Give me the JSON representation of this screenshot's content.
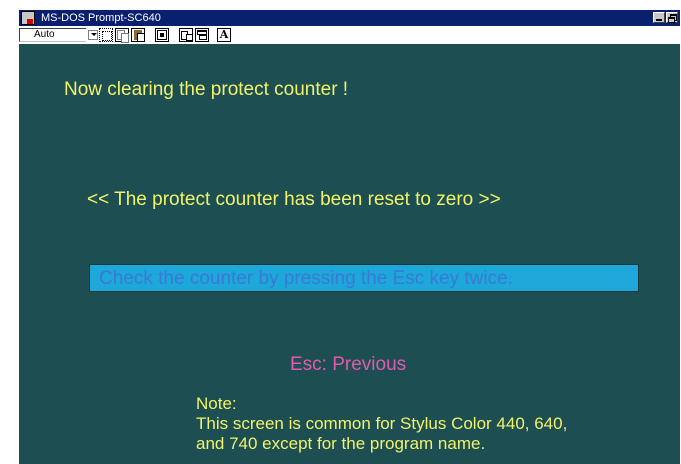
{
  "window": {
    "title": "MS-DOS Prompt-SC640",
    "controls": [
      "minimize",
      "restore"
    ]
  },
  "toolbar": {
    "font_size_value": "Auto",
    "buttons": [
      {
        "name": "mark",
        "icon": "mark-icon"
      },
      {
        "name": "copy",
        "icon": "copy-icon"
      },
      {
        "name": "paste",
        "icon": "paste-icon"
      },
      {
        "name": "full-screen",
        "icon": "fullscreen-icon"
      },
      {
        "name": "properties",
        "icon": "properties-icon"
      },
      {
        "name": "background",
        "icon": "background-icon"
      },
      {
        "name": "font",
        "icon": "font-icon",
        "label": "A"
      }
    ]
  },
  "console": {
    "heading": "Now clearing the protect counter !",
    "reset_message": "<< The protect counter has been reset to zero >>",
    "check_message": "Check the counter by pressing the Esc key twice.",
    "esc_hint": "Esc: Previous",
    "note": {
      "label": "Note:",
      "line1": "This screen is common for Stylus Color 440, 640,",
      "line2": "and 740 except for the program name."
    }
  },
  "colors": {
    "console_background": "#1c4e52",
    "text_yellow": "#f2f26a",
    "highlight_box": "#1ea7d9",
    "highlight_text": "#3a7ad6",
    "esc_text": "#e25ab0",
    "titlebar": "#0a1f6e"
  }
}
